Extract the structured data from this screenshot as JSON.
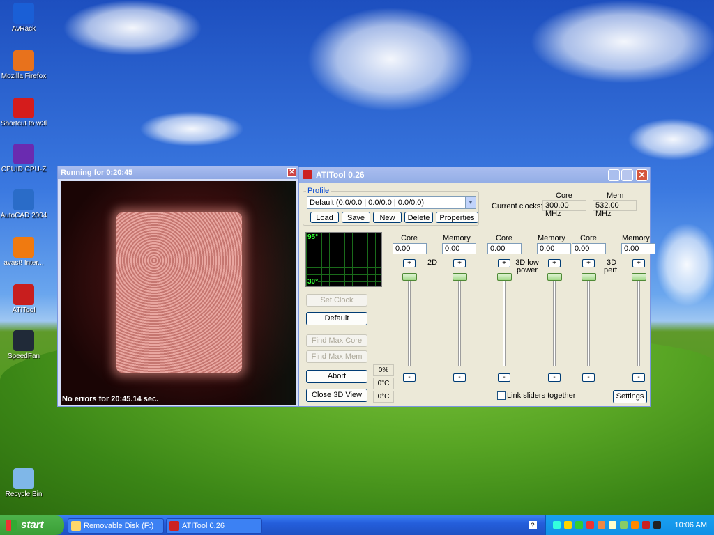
{
  "desktop": {
    "icons": [
      {
        "label": "AvRack",
        "color": "#1a5fd6"
      },
      {
        "label": "Mozilla Firefox",
        "color": "#e8721c"
      },
      {
        "label": "Shortcut to w3l",
        "color": "#d51c1c"
      },
      {
        "label": "CPUID CPU-Z",
        "color": "#6a2bb0"
      },
      {
        "label": "AutoCAD 2004",
        "color": "#2a6cc8"
      },
      {
        "label": "avast! Inter...",
        "color": "#f07a10"
      },
      {
        "label": "ATITool",
        "color": "#c81e1e"
      },
      {
        "label": "SpeedFan",
        "color": "#202a38"
      },
      {
        "label": "Recycle Bin",
        "color": "#7fb7e8"
      }
    ]
  },
  "win3d": {
    "title": "Running for 0:20:45",
    "close_glyph": "✕",
    "status": "No errors for 20:45.14 sec."
  },
  "ati": {
    "title": "ATITool 0.26",
    "close_glyph": "✕",
    "profile": {
      "legend": "Profile",
      "selected": "Default (0.0/0.0 | 0.0/0.0 | 0.0/0.0)",
      "buttons": [
        "Load",
        "Save",
        "New",
        "Delete",
        "Properties"
      ]
    },
    "clocks": {
      "label": "Current clocks:",
      "core_header": "Core",
      "mem_header": "Mem",
      "core_value": "300.00 MHz",
      "mem_value": "532.00 MHz"
    },
    "graph": {
      "top": "95°",
      "bottom": "30°"
    },
    "actions": {
      "set_clock": "Set Clock",
      "default": "Default",
      "find_max_core": "Find Max Core",
      "find_max_mem": "Find Max Mem",
      "abort": "Abort",
      "close_3d": "Close 3D View"
    },
    "readouts": [
      "0%",
      "0°C",
      "0°C"
    ],
    "groups": [
      {
        "mode": "2D",
        "core_label": "Core",
        "mem_label": "Memory",
        "core_value": "0.00",
        "mem_value": "0.00"
      },
      {
        "mode": "3D low power",
        "core_label": "Core",
        "mem_label": "Memory",
        "core_value": "0.00",
        "mem_value": "0.00"
      },
      {
        "mode": "3D perf.",
        "core_label": "Core",
        "mem_label": "Memory",
        "core_value": "0.00",
        "mem_value": "0.00"
      }
    ],
    "plus": "+",
    "minus": "-",
    "link_label": "Link sliders together",
    "settings": "Settings"
  },
  "taskbar": {
    "start": "start",
    "items": [
      "Removable Disk (F:)",
      "ATITool 0.26"
    ],
    "clock": "10:06 AM"
  }
}
